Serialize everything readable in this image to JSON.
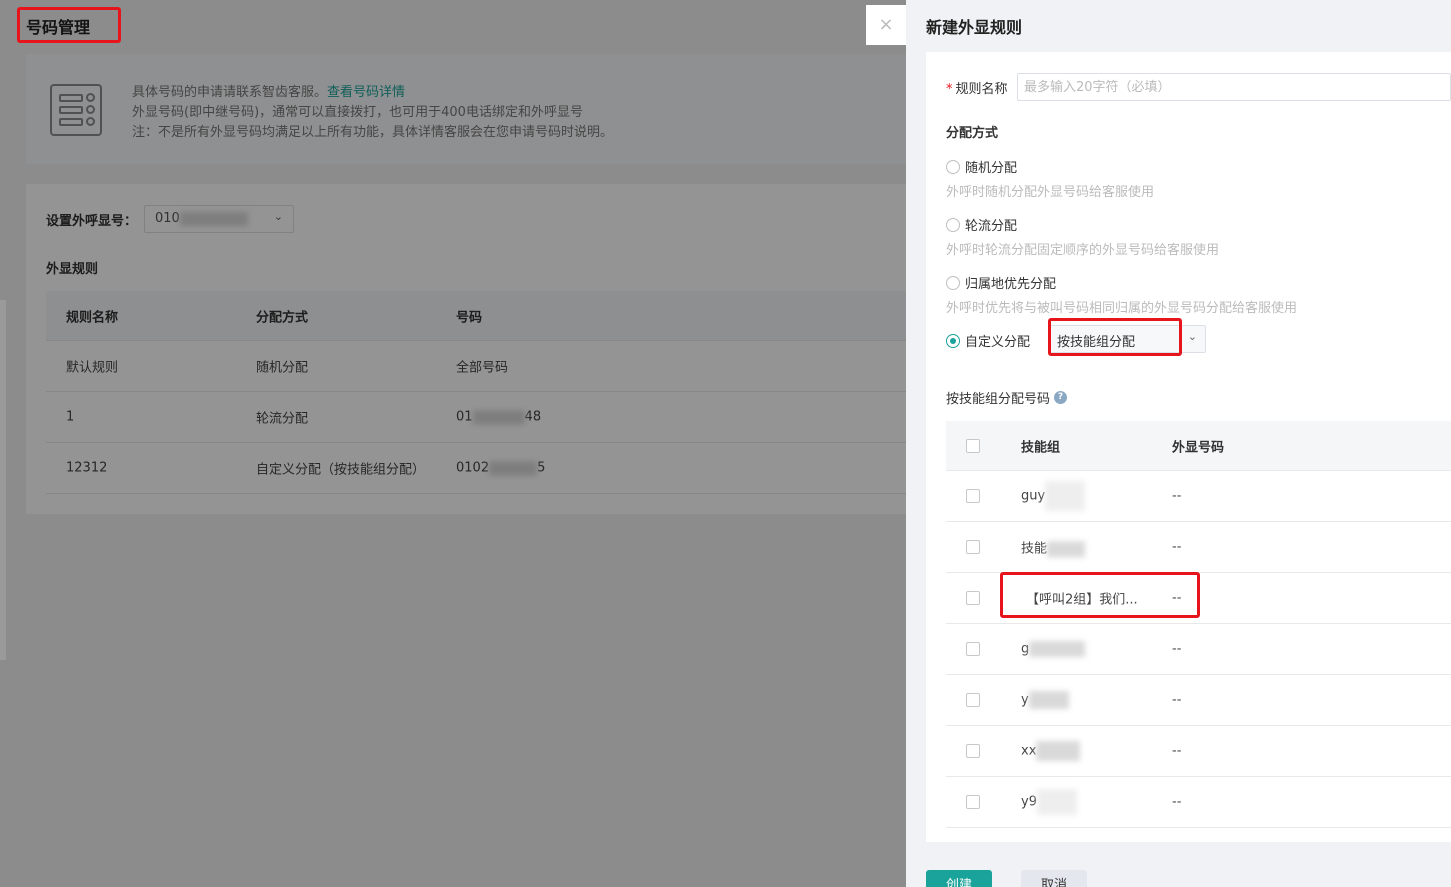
{
  "page": {
    "title": "号码管理",
    "info": {
      "line1": "具体号码的申请请联系智齿客服。",
      "link": "查看号码详情",
      "line2": "外显号码(即中继号码)，通常可以直接拨打，也可用于400电话绑定和外呼显号",
      "line3": "注：不是所有外显号码均满足以上所有功能，具体详情客服会在您申请号码时说明。"
    },
    "outbound_label": "设置外呼显号：",
    "outbound_value_prefix": "010",
    "rules_label": "外显规则",
    "table": {
      "headers": [
        "规则名称",
        "分配方式",
        "号码"
      ],
      "rows": [
        {
          "name": "默认规则",
          "mode": "随机分配",
          "number": "全部号码",
          "num_prefix": "",
          "num_suffix": ""
        },
        {
          "name": "1",
          "mode": "轮流分配",
          "number": "",
          "num_prefix": "01",
          "num_suffix": "48"
        },
        {
          "name": "12312",
          "mode": "自定义分配（按技能组分配）",
          "number": "",
          "num_prefix": "0102",
          "num_suffix": "5"
        }
      ]
    }
  },
  "drawer": {
    "close_glyph": "×",
    "title": "新建外显规则",
    "name_label": "规则名称",
    "name_required_mark": "*",
    "name_placeholder": "最多输入20字符（必填）",
    "assign_title": "分配方式",
    "options": [
      {
        "label": "随机分配",
        "desc": "外呼时随机分配外显号码给客服使用",
        "selected": false
      },
      {
        "label": "轮流分配",
        "desc": "外呼时轮流分配固定顺序的外显号码给客服使用",
        "selected": false
      },
      {
        "label": "归属地优先分配",
        "desc": "外呼时优先将与被叫号码相同归属的外显号码分配给客服使用",
        "selected": false
      },
      {
        "label": "自定义分配",
        "desc": "",
        "selected": true
      }
    ],
    "custom_select_value": "按技能组分配",
    "skill_section_title": "按技能组分配号码",
    "skill_table": {
      "headers": [
        "技能组",
        "外显号码"
      ],
      "rows": [
        {
          "group": "guy",
          "number": "--"
        },
        {
          "group": "技能",
          "number": "--"
        },
        {
          "group": "【呼叫2组】我们...",
          "number": "--"
        },
        {
          "group": "g",
          "number": "--"
        },
        {
          "group": "y",
          "number": "--"
        },
        {
          "group": "xx",
          "number": "--"
        },
        {
          "group": "y9",
          "number": "--"
        }
      ]
    },
    "buttons": {
      "create": "创建",
      "cancel": "取消"
    }
  },
  "colors": {
    "accent": "#1aa39a",
    "highlight": "#e8141b"
  }
}
